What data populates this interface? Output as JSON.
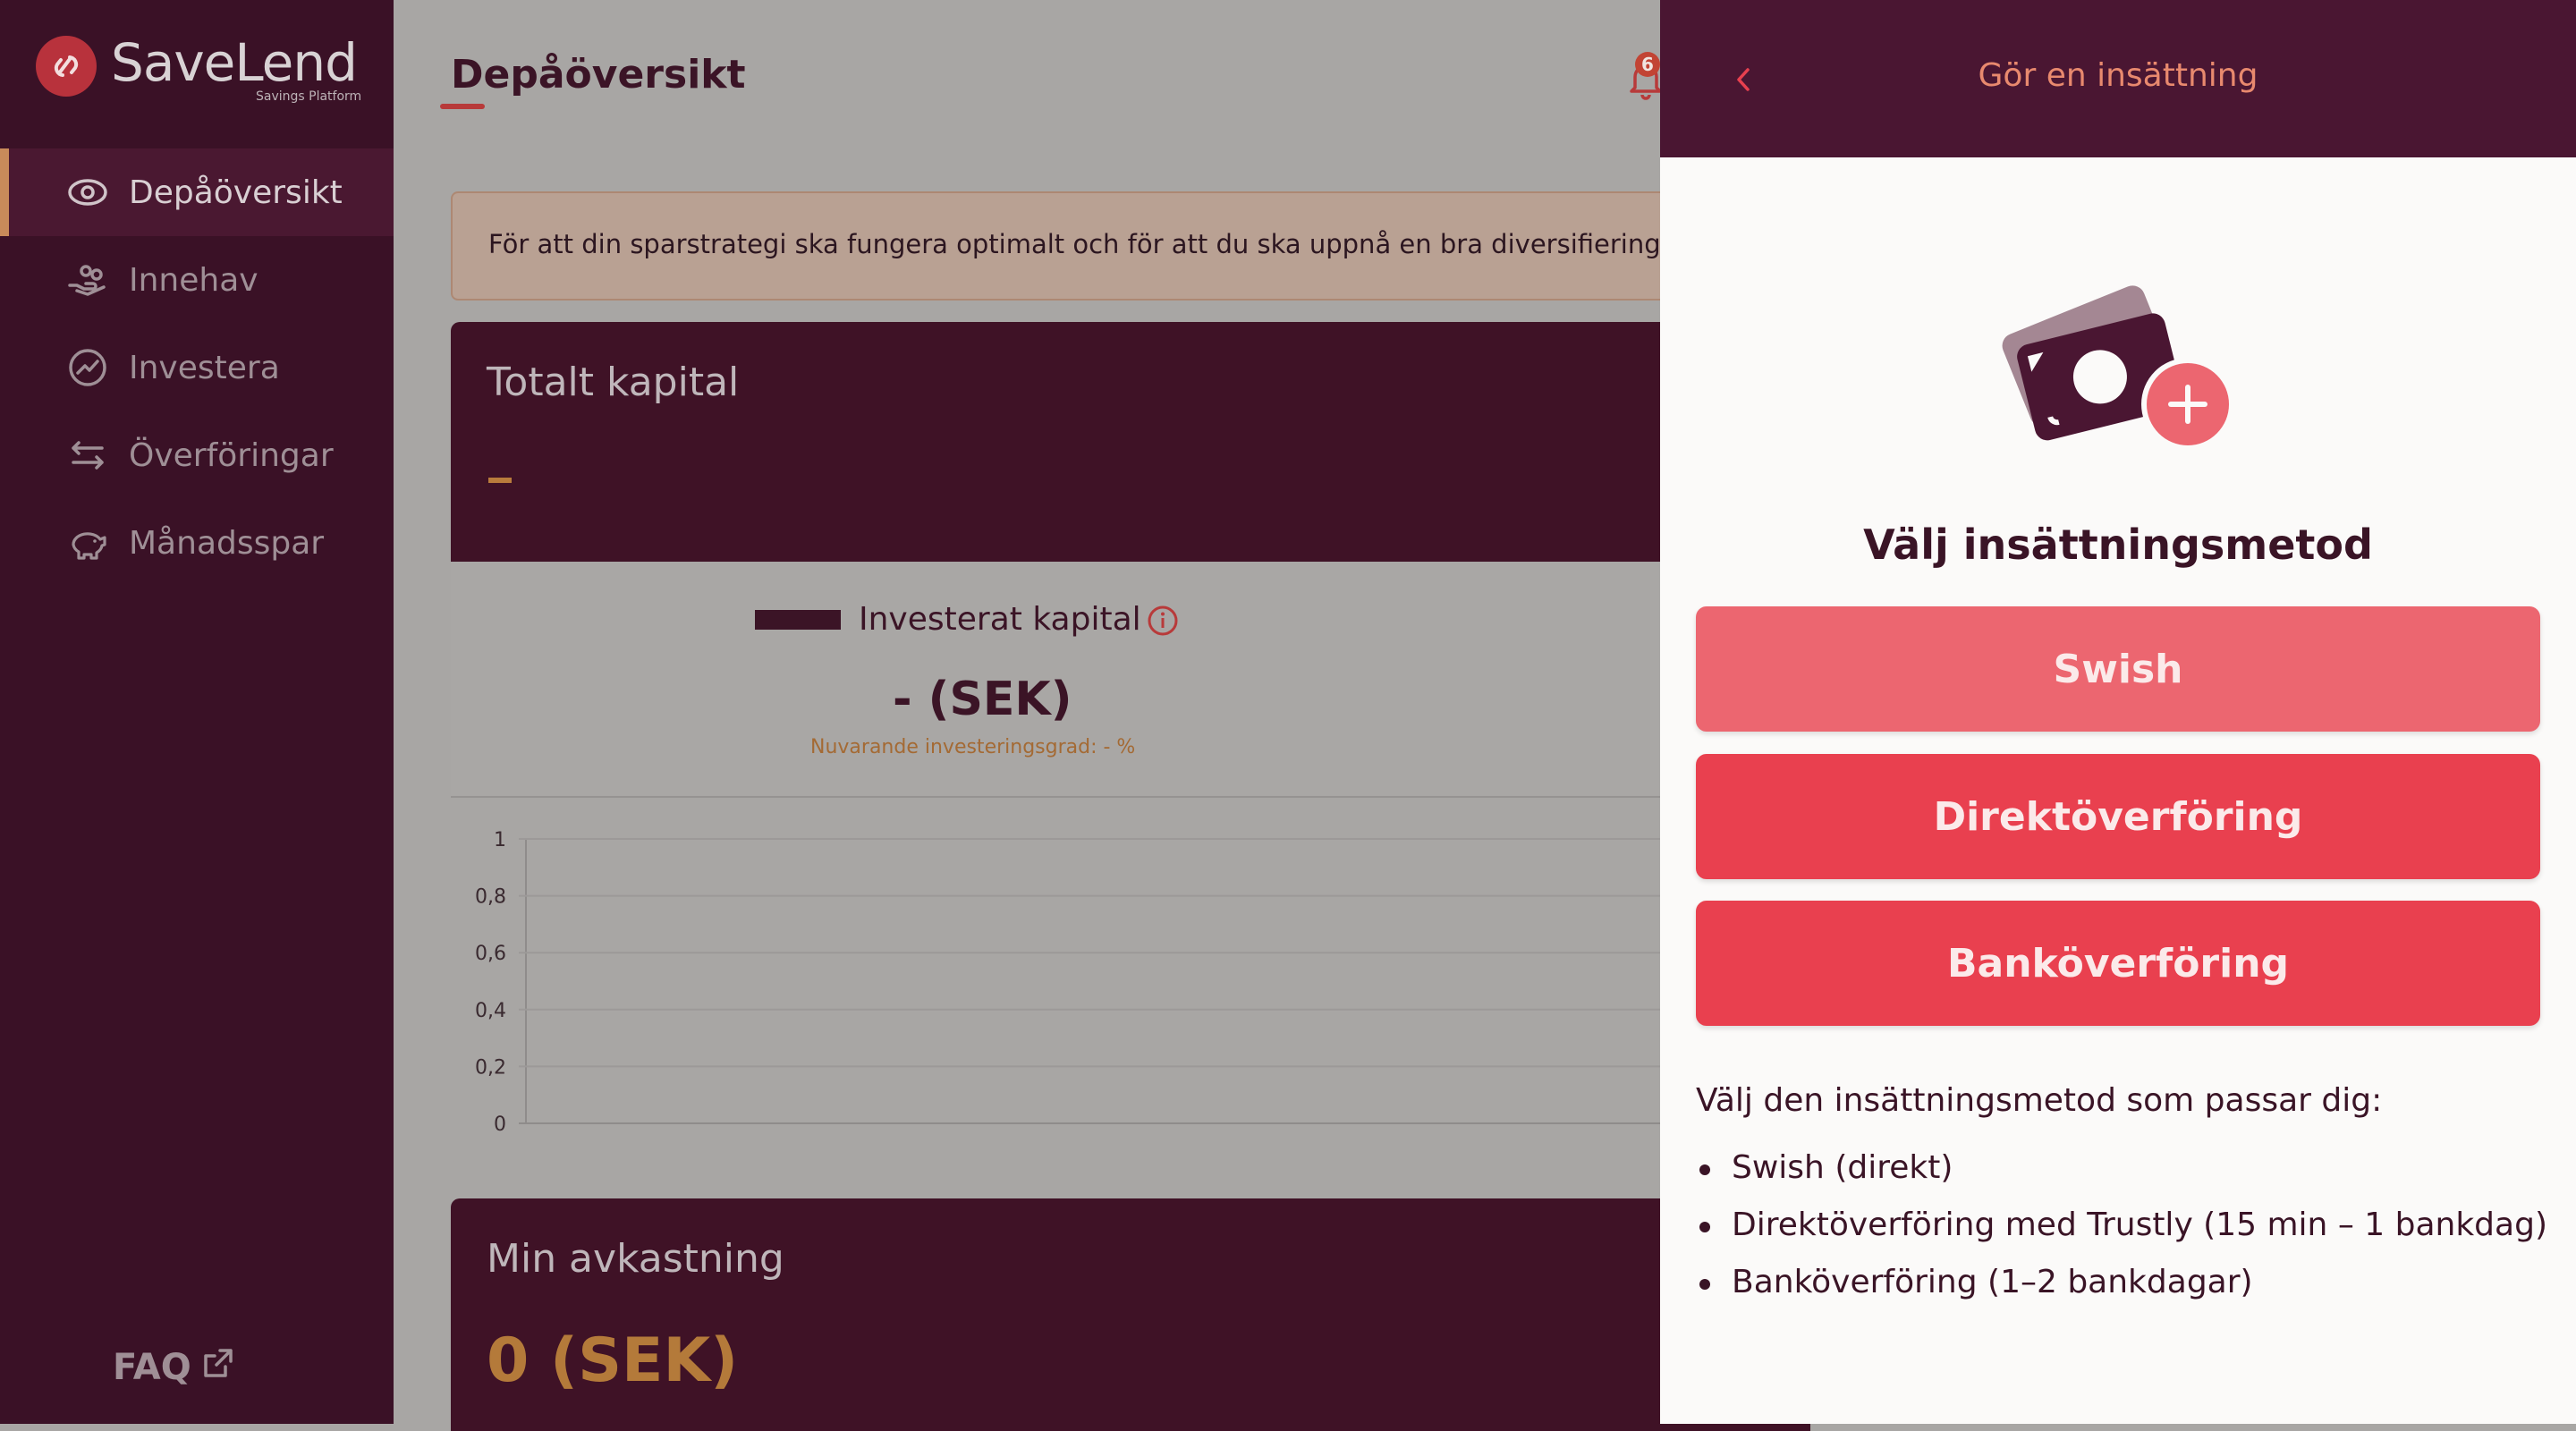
{
  "app": {
    "brand_name": "SaveLend",
    "brand_tagline": "Savings Platform"
  },
  "sidebar": {
    "items": [
      {
        "label": "Depåöversikt",
        "icon": "eye-icon",
        "active": true
      },
      {
        "label": "Innehav",
        "icon": "hand-coins-icon",
        "active": false
      },
      {
        "label": "Investera",
        "icon": "trend-chart-icon",
        "active": false
      },
      {
        "label": "Överföringar",
        "icon": "transfer-arrows-icon",
        "active": false
      },
      {
        "label": "Månadsspar",
        "icon": "piggy-bank-icon",
        "active": false
      }
    ],
    "faq_label": "FAQ"
  },
  "header": {
    "page_title": "Depåöversikt",
    "notification_count": "6"
  },
  "notice": {
    "text": "För att din sparstrategi ska fungera optimalt och för att du ska uppnå en bra diversifiering bör du sät"
  },
  "total_capital": {
    "label": "Totalt kapital",
    "value": "–"
  },
  "invested": {
    "legend_label": "Investerat kapital",
    "value": "- (SEK)",
    "sub_label": "Nuvarande investeringsgrad: - %"
  },
  "chart_data": {
    "type": "line",
    "y_ticks": [
      "1",
      "0,8",
      "0,6",
      "0,4",
      "0,2",
      "0"
    ],
    "ylim": [
      0,
      1
    ],
    "series": [],
    "grid": true
  },
  "returns": {
    "label": "Min avkastning",
    "value": "0 (SEK)"
  },
  "panel": {
    "title": "Gör en insättning",
    "heading": "Välj insättningsmetod",
    "buttons": {
      "swish": "Swish",
      "direkt": "Direktöverföring",
      "bank": "Banköverföring"
    },
    "intro": "Välj den insättningsmetod som passar dig:",
    "methods": [
      "Swish (direkt)",
      "Direktöverföring med Trustly (15 min – 1 bankdag)",
      "Banköverföring (1–2 bankdagar)"
    ]
  },
  "colors": {
    "sidebar_bg": "#3a1126",
    "panel_header_bg": "#4a1632",
    "accent_coral": "#e9404f",
    "accent_swish": "#ec6670",
    "accent_amber": "#b97c3c"
  }
}
